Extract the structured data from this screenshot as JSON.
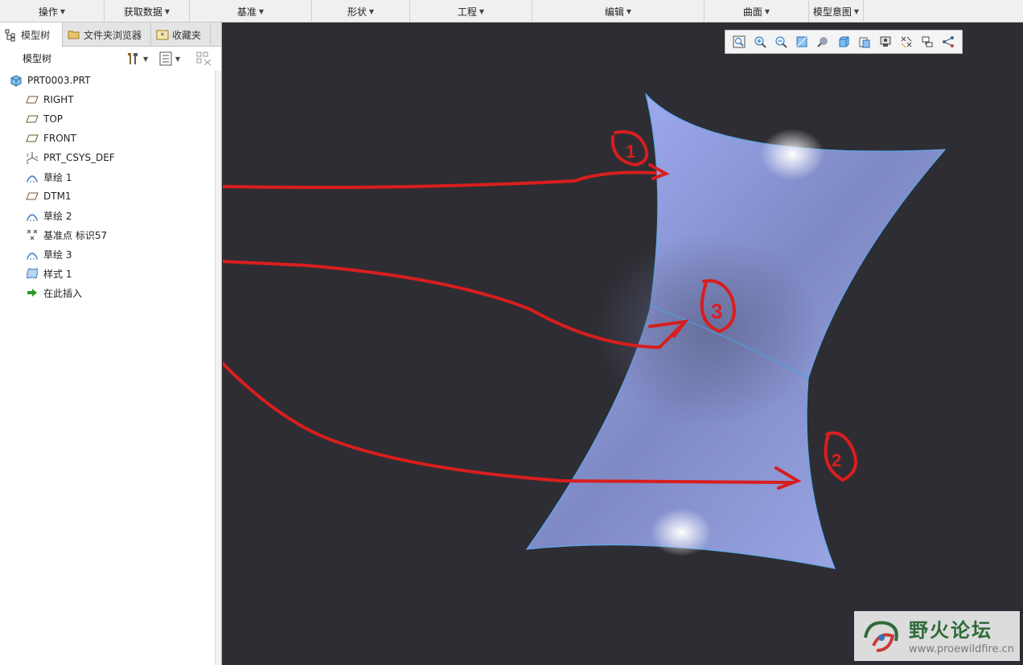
{
  "ribbon": {
    "groups": [
      "操作",
      "获取数据",
      "基准",
      "形状",
      "工程",
      "编辑",
      "曲面",
      "模型意图"
    ]
  },
  "left_panel": {
    "tabs": [
      "模型树",
      "文件夹浏览器",
      "收藏夹"
    ],
    "tree_title": "模型树",
    "root": "PRT0003.PRT",
    "items": [
      "RIGHT",
      "TOP",
      "FRONT",
      "PRT_CSYS_DEF",
      "草绘 1",
      "DTM1",
      "草绘 2",
      "基准点 标识57",
      "草绘 3",
      "样式 1",
      "在此插入"
    ]
  },
  "view_toolbar": {
    "icons": [
      "refit-icon",
      "zoom-in-icon",
      "zoom-out-icon",
      "repaint-icon",
      "display-style-icon",
      "saved-orientations-icon",
      "view-manager-icon",
      "perspective-icon",
      "datum-display-icon",
      "annotation-display-icon",
      "spin-center-icon"
    ]
  },
  "annotations": {
    "labels": [
      "1",
      "3",
      "2"
    ]
  },
  "watermark": {
    "brand": "野火论坛",
    "url": "www.proewildfire.cn"
  },
  "colors": {
    "viewport_bg": "#2e2d33",
    "surface": "#9aa8f0",
    "edge": "#4aa3e8",
    "annotation_red": "#d81e1e"
  }
}
